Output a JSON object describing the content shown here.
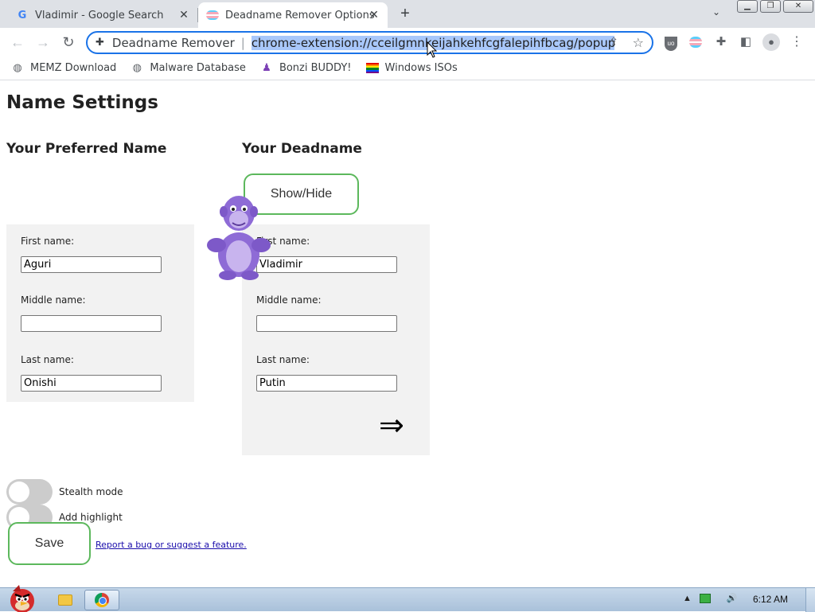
{
  "browser": {
    "tabs": [
      {
        "title": "Vladimir - Google Search",
        "favicon": "google-g-icon",
        "active": false
      },
      {
        "title": "Deadname Remover Options",
        "favicon": "trans-flag-icon",
        "active": true
      }
    ],
    "address_bar": {
      "site_name": "Deadname Remover",
      "url": "chrome-extension://cceilgmnkeijahkehfcgfalepihfbcag/popup/optio"
    },
    "bookmarks": [
      {
        "label": "MEMZ Download",
        "icon": "globe-icon"
      },
      {
        "label": "Malware Database",
        "icon": "globe-icon"
      },
      {
        "label": "Bonzi BUDDY!",
        "icon": "bonzi-icon"
      },
      {
        "label": "Windows ISOs",
        "icon": "rainbow-flag-icon"
      }
    ]
  },
  "page": {
    "title": "Name Settings",
    "preferred_heading": "Your Preferred Name",
    "deadname_heading": "Your Deadname",
    "show_hide_label": "Show/Hide",
    "preferred": {
      "first_label": "First name:",
      "first_value": "Aguri",
      "middle_label": "Middle name:",
      "middle_value": "",
      "last_label": "Last name:",
      "last_value": "Onishi"
    },
    "deadname": {
      "first_label": "First name:",
      "first_value": "Vladimir",
      "middle_label": "Middle name:",
      "middle_value": "",
      "last_label": "Last name:",
      "last_value": "Putin",
      "arrow": "⇒"
    },
    "toggles": {
      "stealth_label": "Stealth mode",
      "stealth_on": false,
      "highlight_label": "Add highlight",
      "highlight_on": false
    },
    "save_label": "Save",
    "report_link": "Report a bug or suggest a feature."
  },
  "taskbar": {
    "clock": "6:12 AM"
  },
  "colors": {
    "accent_green": "#5cb85c",
    "panel_bg": "#f2f2f2",
    "omnibox_border": "#1a73e8",
    "url_selection": "#a8c7fa"
  }
}
